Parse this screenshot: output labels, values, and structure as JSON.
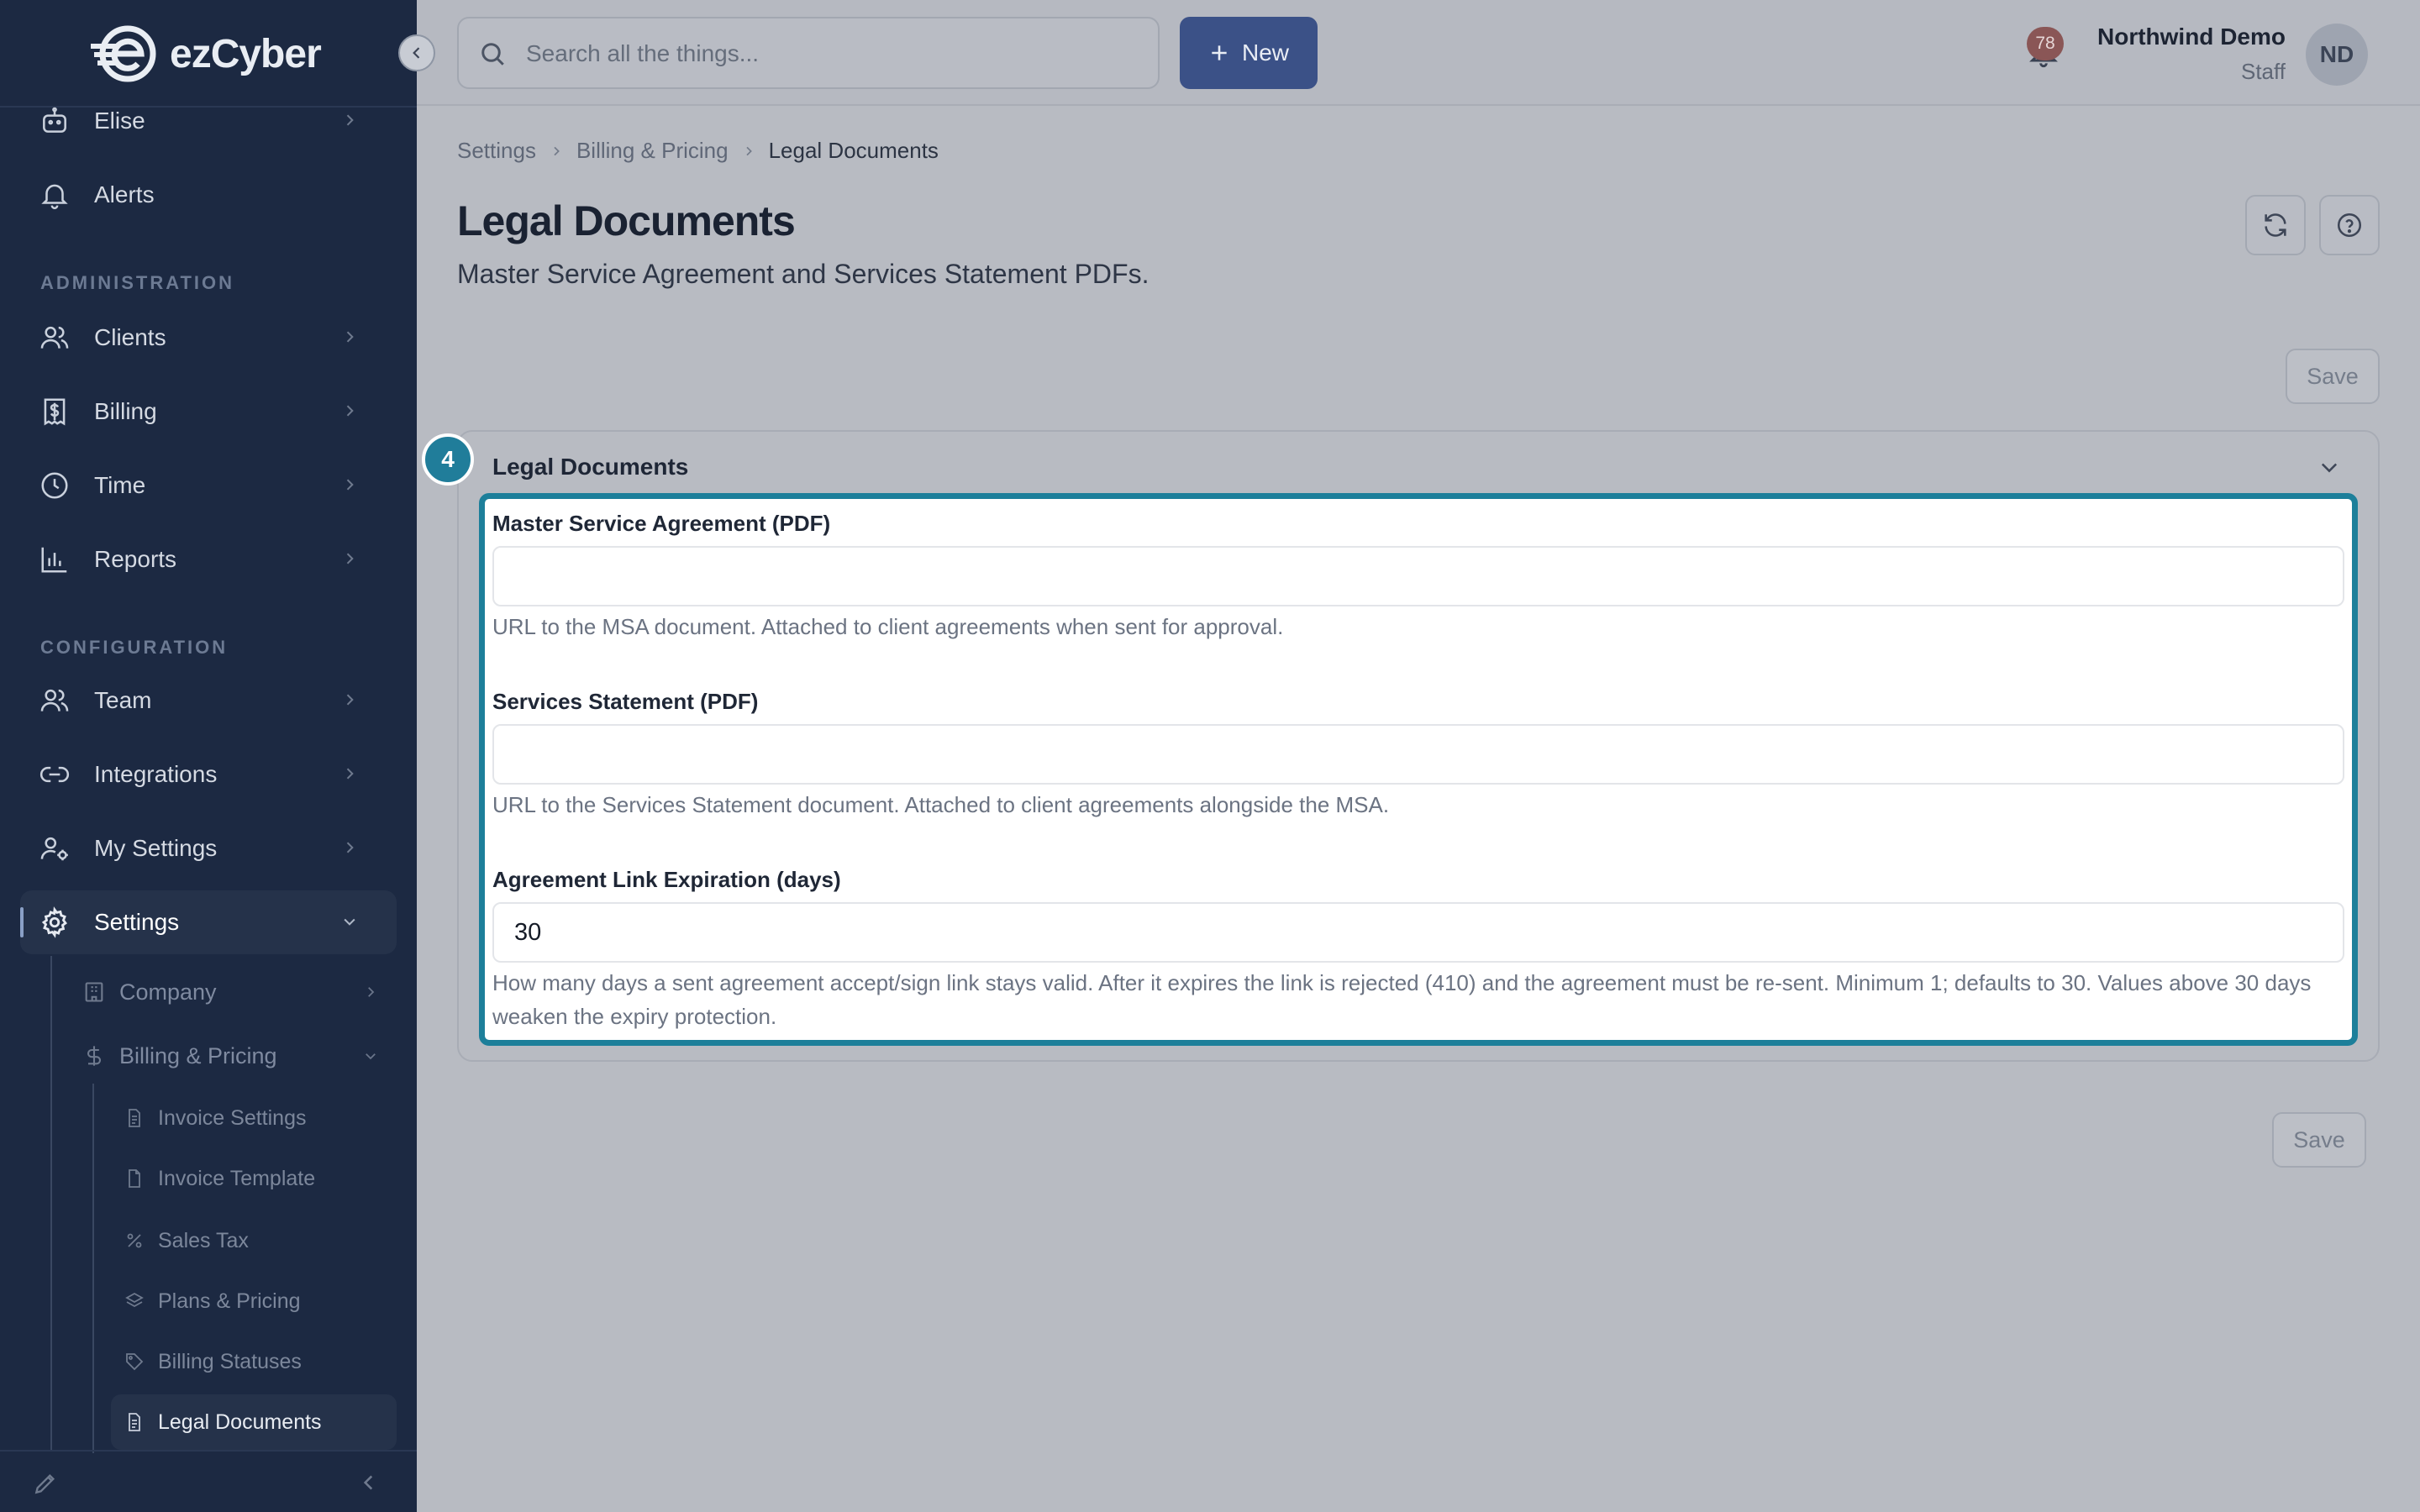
{
  "app": {
    "logo_text": "ezCyber"
  },
  "search": {
    "placeholder": "Search all the things..."
  },
  "toolbar": {
    "new_label": "New",
    "notifications_count": "78"
  },
  "user": {
    "name": "Northwind Demo",
    "role": "Staff",
    "initials": "ND"
  },
  "sidebar": {
    "top_items": [
      {
        "label": "Elise"
      },
      {
        "label": "Alerts"
      }
    ],
    "section_admin": "ADMINISTRATION",
    "admin_items": [
      {
        "label": "Clients"
      },
      {
        "label": "Billing"
      },
      {
        "label": "Time"
      },
      {
        "label": "Reports"
      }
    ],
    "section_config": "CONFIGURATION",
    "config_items": [
      {
        "label": "Team"
      },
      {
        "label": "Integrations"
      },
      {
        "label": "My Settings"
      },
      {
        "label": "Settings"
      }
    ],
    "settings_sub": [
      {
        "label": "Company"
      },
      {
        "label": "Billing & Pricing"
      }
    ],
    "billing_sub": [
      {
        "label": "Invoice Settings"
      },
      {
        "label": "Invoice Template"
      },
      {
        "label": "Sales Tax"
      },
      {
        "label": "Plans & Pricing"
      },
      {
        "label": "Billing Statuses"
      },
      {
        "label": "Legal Documents"
      }
    ]
  },
  "breadcrumb": [
    "Settings",
    "Billing & Pricing",
    "Legal Documents"
  ],
  "page": {
    "title": "Legal Documents",
    "subtitle": "Master Service Agreement and Services Statement PDFs.",
    "save_label": "Save"
  },
  "card": {
    "step": "4",
    "title": "Legal Documents",
    "fields": [
      {
        "label": "Master Service Agreement (PDF)",
        "value": "",
        "help": "URL to the MSA document. Attached to client agreements when sent for approval."
      },
      {
        "label": "Services Statement (PDF)",
        "value": "",
        "help": "URL to the Services Statement document. Attached to client agreements alongside the MSA."
      },
      {
        "label": "Agreement Link Expiration (days)",
        "value": "30",
        "help": "How many days a sent agreement accept/sign link stays valid. After it expires the link is rejected (410) and the agreement must be re-sent. Minimum 1; defaults to 30. Values above 30 days weaken the expiry protection."
      }
    ]
  },
  "colors": {
    "sidebar_bg": "#1c2942",
    "accent": "#1d7f9a",
    "primary_button": "#3b5187",
    "badge": "#8a5656"
  }
}
